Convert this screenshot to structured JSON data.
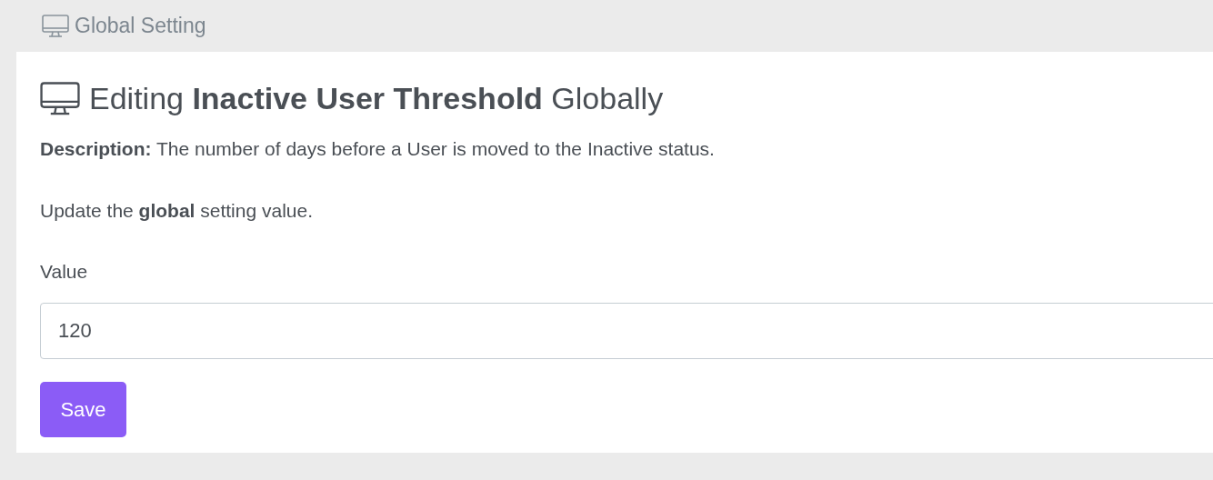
{
  "breadcrumb": {
    "label": "Global Setting"
  },
  "heading": "Editing **Inactive User Threshold** Globally",
  "description": "**Description:** The number of days before a User is moved to the Inactive status.",
  "instruction": "Update the **global** setting value.",
  "field": {
    "label": "Value",
    "value": "120"
  },
  "buttons": [
    "Save"
  ]
}
